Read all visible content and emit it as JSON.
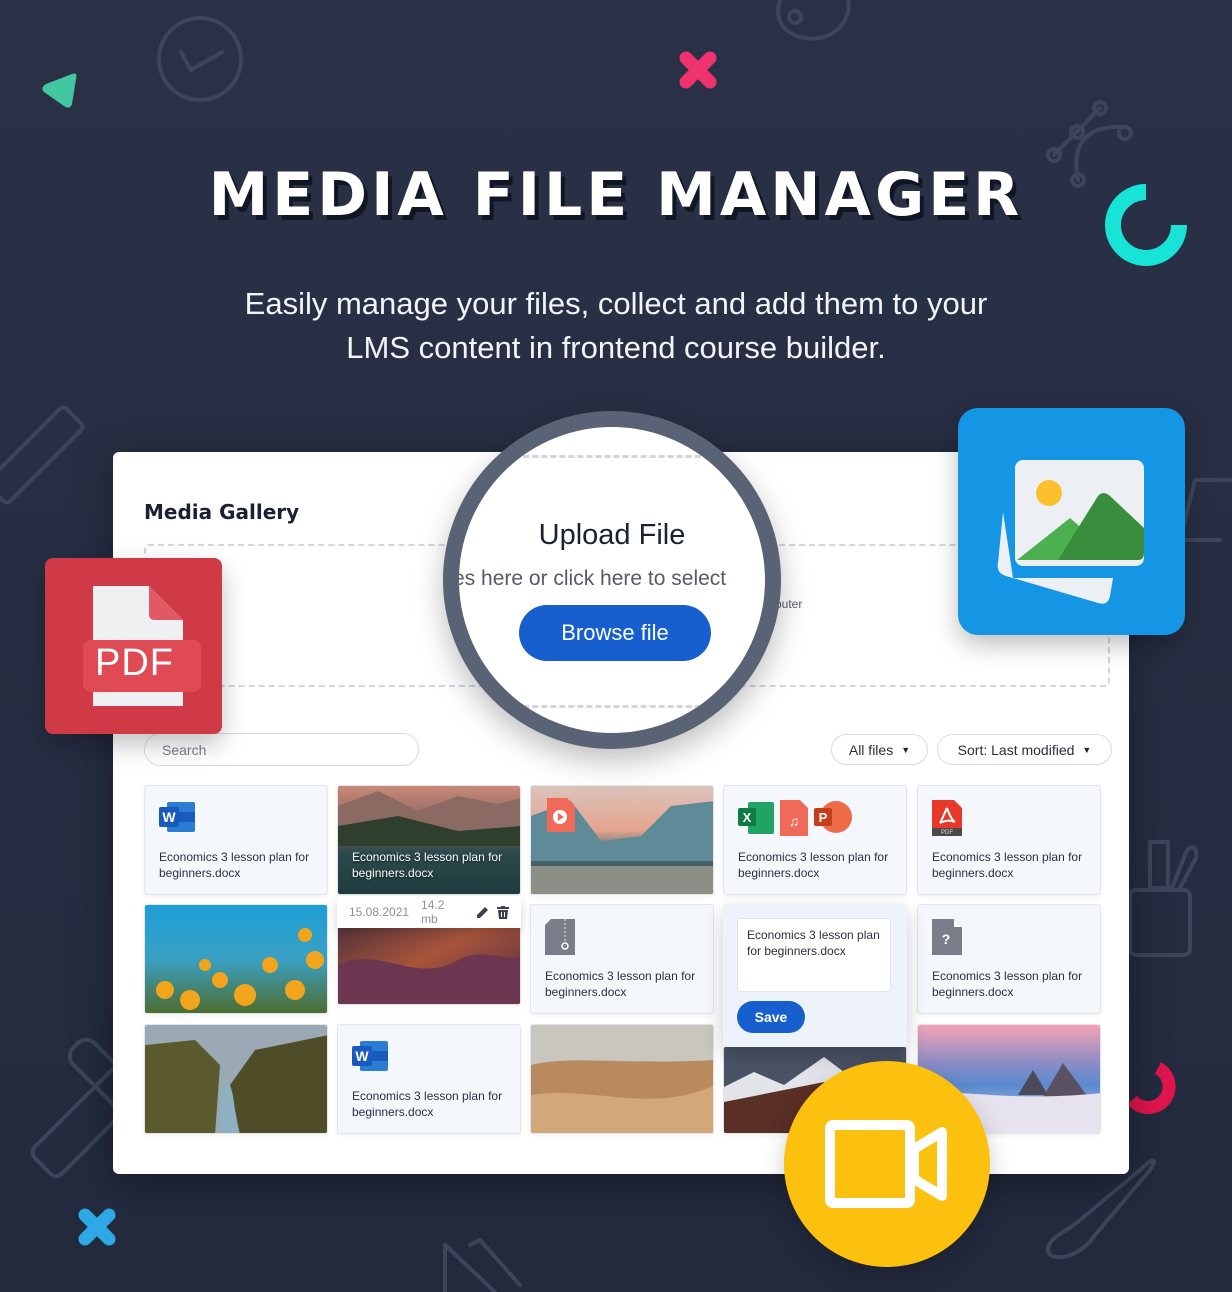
{
  "hero": {
    "title": "MEDIA FILE MANAGER",
    "subtitle_line1": "Easily manage your files, collect and add them to your",
    "subtitle_line2": "LMS content in frontend course builder."
  },
  "gallery": {
    "title": "Media Gallery",
    "dropzone_partial_text": "outer",
    "upload": {
      "title": "Upload File",
      "description": "es here or click here to select",
      "browse_label": "Browse file"
    },
    "search": {
      "placeholder": "Search",
      "value": ""
    },
    "filter": {
      "selected": "All files",
      "caret": "▼"
    },
    "sort": {
      "selected": "Sort: Last modified",
      "caret": "▼"
    },
    "files": [
      {
        "type": "docx",
        "icon": "word-icon",
        "name": "Economics 3 lesson plan for beginners.docx"
      },
      {
        "type": "image",
        "scene": "mountain-lake",
        "name": "Economics 3 lesson plan for beginners.docx",
        "date": "15.08.2021",
        "size": "14.2 mb",
        "hovered": true
      },
      {
        "type": "video",
        "scene": "valley-river",
        "icon": "video-file-icon"
      },
      {
        "type": "multi",
        "icons": [
          "excel-icon",
          "audio-file-icon",
          "powerpoint-icon"
        ],
        "name": "Economics 3 lesson plan for beginners.docx"
      },
      {
        "type": "pdf",
        "icon": "pdf-file-icon",
        "name": "Economics 3 lesson plan for beginners.docx"
      },
      {
        "type": "image",
        "scene": "yellow-flowers"
      },
      {
        "type": "image",
        "scene": "canyon"
      },
      {
        "type": "zip",
        "icon": "zip-file-icon",
        "name": "Economics 3 lesson plan for beginners.docx"
      },
      {
        "type": "editing",
        "name": "Economics 3 lesson plan for beginners.docx",
        "save_label": "Save"
      },
      {
        "type": "unknown",
        "icon": "unknown-file-icon",
        "name": "Economics 3 lesson plan for beginners.docx"
      },
      {
        "type": "image",
        "scene": "gorge-river"
      },
      {
        "type": "docx",
        "icon": "word-icon",
        "name": "Economics 3 lesson plan for beginners.docx"
      },
      {
        "type": "image",
        "scene": "desert-dunes"
      },
      {
        "type": "image",
        "scene": "snowy-peaks"
      },
      {
        "type": "image",
        "scene": "peaks-above-clouds"
      }
    ]
  },
  "badges": {
    "pdf_label": "PDF"
  },
  "colors": {
    "background": "#28304a",
    "primary_button": "#175fcf",
    "pdf_badge": "#d03a46",
    "image_badge": "#1596e4",
    "video_badge": "#fcc00e",
    "accent_teal": "#17e3d6",
    "accent_pink": "#f0336f",
    "accent_green": "#43c7a2",
    "accent_blue": "#2ea8e6",
    "accent_red": "#e0154e"
  }
}
